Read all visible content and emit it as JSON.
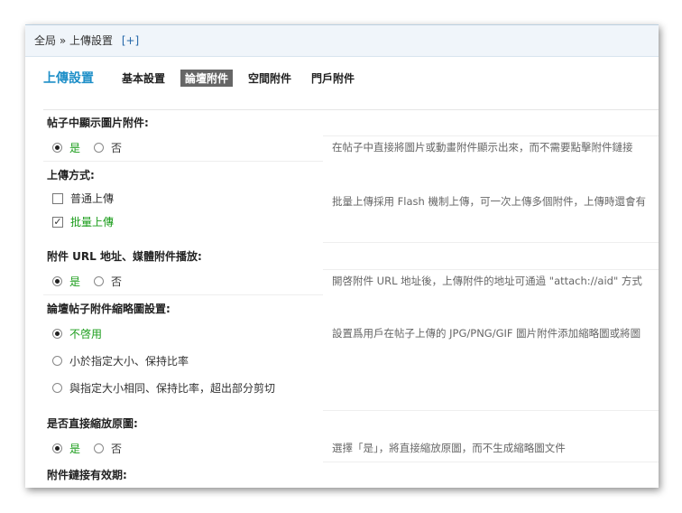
{
  "breadcrumb": {
    "text": "全局 » 上傳設置",
    "plus": "[+]"
  },
  "page_heading": "上傳設置",
  "tabs": [
    {
      "label": "基本設置",
      "active": false
    },
    {
      "label": "論壇附件",
      "active": true
    },
    {
      "label": "空間附件",
      "active": false
    },
    {
      "label": "門戶附件",
      "active": false
    }
  ],
  "sections": {
    "show_image": {
      "title": "帖子中顯示圖片附件:",
      "yes": "是",
      "no": "否",
      "desc": "在帖子中直接將圖片或動畫附件顯示出來，而不需要點擊附件鏈接"
    },
    "upload_mode": {
      "title": "上傳方式:",
      "normal": "普通上傳",
      "batch": "批量上傳",
      "desc": "批量上傳採用 Flash 機制上傳，可一次上傳多個附件，上傳時還會有"
    },
    "attach_url": {
      "title": "附件 URL 地址、媒體附件播放:",
      "yes": "是",
      "no": "否",
      "desc": "開啓附件 URL 地址後，上傳附件的地址可通過 \"attach://aid\" 方式"
    },
    "thumbnail": {
      "title": "論壇帖子附件縮略圖設置:",
      "opt1": "不啓用",
      "opt2": "小於指定大小、保持比率",
      "opt3": "與指定大小相同、保持比率，超出部分剪切",
      "desc": "設置爲用戶在帖子上傳的 JPG/PNG/GIF 圖片附件添加縮略圖或將圖"
    },
    "zoom_original": {
      "title": "是否直接縮放原圖:",
      "yes": "是",
      "no": "否",
      "desc": "選擇「是」，將直接縮放原圖，而不生成縮略圖文件"
    },
    "link_expiry": {
      "title": "附件鏈接有效期:"
    }
  },
  "colors": {
    "heading": "#1e8fc8",
    "checked_label": "#1a9c1a",
    "active_tab": "#666666"
  }
}
